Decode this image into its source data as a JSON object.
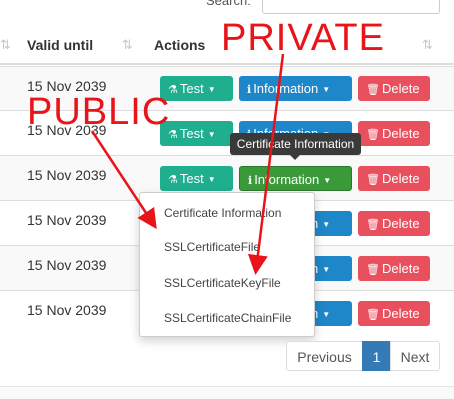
{
  "search": {
    "label": "Search:",
    "placeholder": ""
  },
  "table": {
    "columns": [
      {
        "label": ""
      },
      {
        "label": "Valid until"
      },
      {
        "label": "Actions"
      }
    ],
    "sort_icon": "⇅",
    "rows": [
      {
        "valid_until": "15 Nov 2039"
      },
      {
        "valid_until": "15 Nov 2039"
      },
      {
        "valid_until": "15 Nov 2039"
      },
      {
        "valid_until": "15 Nov 2039"
      },
      {
        "valid_until": "15 Nov 2039"
      },
      {
        "valid_until": "15 Nov 2039"
      }
    ]
  },
  "actions": {
    "test_label": "Test",
    "information_label": "Information",
    "delete_label": "Delete",
    "test_icon": "flask-icon",
    "information_icon": "info-icon",
    "delete_icon": "trash-icon"
  },
  "tooltip": {
    "text": "Certificate Information"
  },
  "dropdown": {
    "items": [
      {
        "label": "Certificate Information"
      },
      {
        "label": "SSLCertificateFile"
      },
      {
        "label": "SSLCertificateKeyFile"
      },
      {
        "label": "SSLCertificateChainFile"
      }
    ]
  },
  "pagination": {
    "previous": "Previous",
    "current": "1",
    "next": "Next"
  },
  "annotations": {
    "private": "PRIVATE",
    "public": "PUBLIC"
  },
  "colors": {
    "test": "#1fae8e",
    "information": "#1e87c9",
    "information_active": "#3a9a3a",
    "delete": "#e9505e",
    "annotation": "#e8141a",
    "pager_active": "#337ab7"
  }
}
